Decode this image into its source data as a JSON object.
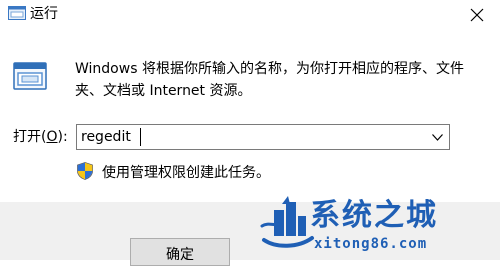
{
  "window": {
    "title": "运行",
    "icon": "run-icon",
    "close_icon": "close-icon"
  },
  "description": "Windows 将根据你所输入的名称，为你打开相应的程序、文件夹、文档或 Internet 资源。",
  "open": {
    "label_prefix": "打开(",
    "label_access_key": "O",
    "label_suffix": "):",
    "value": "regedit",
    "dropdown_icon": "chevron-down-icon"
  },
  "admin_note": {
    "icon": "shield-icon",
    "text": "使用管理权限创建此任务。"
  },
  "buttons": {
    "ok_label": "确定"
  },
  "watermark": {
    "brand": "系统之城",
    "url": "xitong86.com",
    "color": "#1f5fb5"
  }
}
